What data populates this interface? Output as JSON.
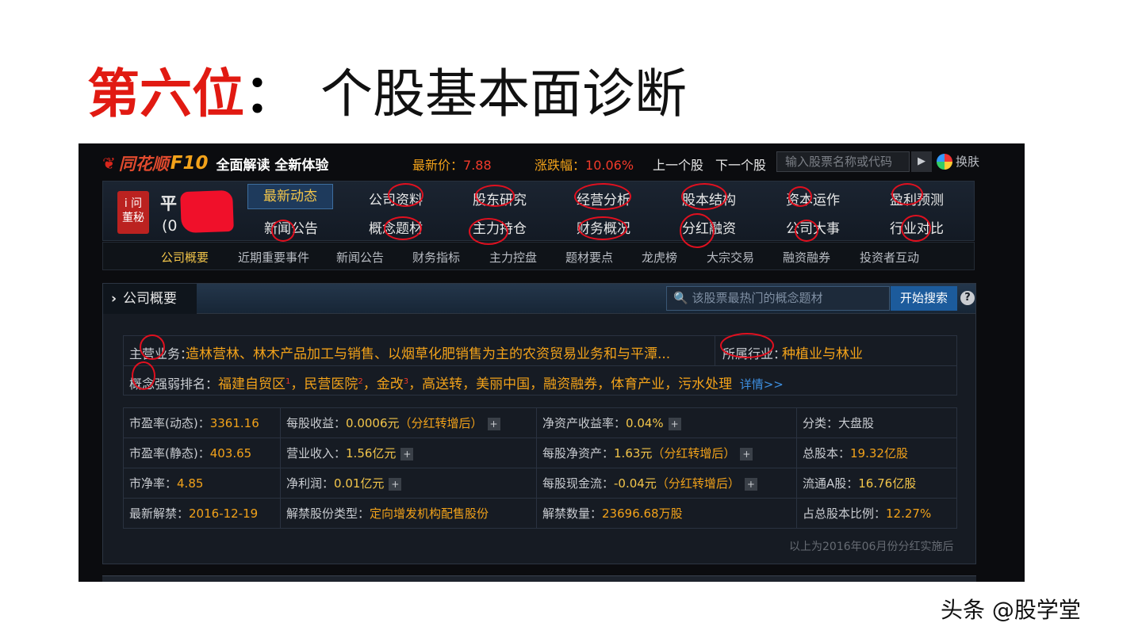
{
  "slide": {
    "rank": "第六位",
    "colon": "：",
    "topic": "个股基本面诊断"
  },
  "header": {
    "logo_mark": "❦",
    "logo_name": "同花顺",
    "logo_f10": "F10",
    "slogan": "全面解读 全新体验",
    "price_label": "最新价：",
    "price_value": "7.88",
    "change_label": "涨跌幅：",
    "change_value": "10.06%",
    "prev_stock": "上一个股",
    "next_stock": "下一个股",
    "search_placeholder": "输入股票名称或代码",
    "search_go": "▶",
    "skin_label": "换肤"
  },
  "stock": {
    "badge_line1": "i 问",
    "badge_line2": "董秘",
    "name_visible": "平",
    "code_visible": "(0"
  },
  "tabs": {
    "row1": [
      "最新动态",
      "公司资料",
      "股东研究",
      "经营分析",
      "股本结构",
      "资本运作",
      "盈利预测"
    ],
    "row2": [
      "新闻公告",
      "概念题材",
      "主力持仓",
      "财务概况",
      "分红融资",
      "公司大事",
      "行业对比"
    ]
  },
  "subnav": [
    "公司概要",
    "近期重要事件",
    "新闻公告",
    "财务指标",
    "主力控盘",
    "题材要点",
    "龙虎榜",
    "大宗交易",
    "融资融券",
    "投资者互动"
  ],
  "section": {
    "chevron": "›",
    "title": "公司概要",
    "concept_search_placeholder": "该股票最热门的概念题材",
    "concept_search_button": "开始搜索",
    "help": "?"
  },
  "business": {
    "main_label": "主营业务：",
    "main_value": "造林营林、林木产品加工与销售、以烟草化肥销售为主的农资贸易业务和与平潭...",
    "industry_label": "所属行业：",
    "industry_value": "种植业与林业",
    "concept_label": "概念强弱排名：",
    "concepts": [
      {
        "name": "福建自贸区",
        "rank": "1"
      },
      {
        "name": "民营医院",
        "rank": "2"
      },
      {
        "name": "金改",
        "rank": "3"
      }
    ],
    "more_concepts": "高送转，美丽中国，融资融券，体育产业，污水处理",
    "sep": "，",
    "detail_link": "详情>>"
  },
  "metrics": {
    "plus": "+",
    "r1": {
      "a_l": "市盈率(动态)：",
      "a_v": "3361.16",
      "b_l": "每股收益：",
      "b_v": "0.0006元",
      "b_n": "（分红转增后）",
      "c_l": "净资产收益率：",
      "c_v": "0.04%",
      "d_l": "分类：",
      "d_v": "大盘股"
    },
    "r2": {
      "a_l": "市盈率(静态)：",
      "a_v": "403.65",
      "b_l": "营业收入：",
      "b_v": "1.56亿元",
      "c_l": "每股净资产：",
      "c_v": "1.63元",
      "c_n": "（分红转增后）",
      "d_l": "总股本：",
      "d_v": "19.32亿股"
    },
    "r3": {
      "a_l": "市净率：",
      "a_v": "4.85",
      "b_l": "净利润：",
      "b_v": "0.01亿元",
      "c_l": "每股现金流：",
      "c_v": "-0.04元",
      "c_n": "（分红转增后）",
      "d_l": "流通A股：",
      "d_v": "16.76亿股"
    },
    "r4": {
      "a_l": "最新解禁：",
      "a_v": "2016-12-19",
      "b_l": "解禁股份类型：",
      "b_v": "定向增发机构配售股份",
      "c_l": "解禁数量：",
      "c_v": "23696.68万股",
      "d_l": "占总股本比例：",
      "d_v": "12.27%"
    }
  },
  "footnote": "以上为2016年06月份分红实施后",
  "watermark": "头条 @股学堂",
  "colors": {
    "title_red": "#e11a12",
    "accent_orange": "#f2a21a",
    "price_red": "#f23a2a",
    "annotation_red": "#e0101f",
    "panel_bg": "#0b0c0f"
  }
}
